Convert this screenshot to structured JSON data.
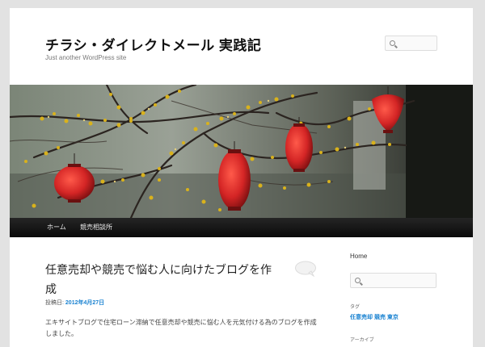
{
  "site": {
    "title": "チラシ・ダイレクトメール 実践記",
    "description": "Just another WordPress site"
  },
  "nav": {
    "items": [
      {
        "label": "ホーム"
      },
      {
        "label": "競売相談所"
      }
    ]
  },
  "post": {
    "title": "任意売却や競売で悩む人に向けたブログを作成",
    "meta_label": "投稿日:",
    "date": "2012年4月27日",
    "excerpt": "エキサイトブログで住宅ローン滞納で任意売却や競売に悩む人を元気付ける為のブログを作成しました。"
  },
  "sidebar": {
    "home_label": "Home",
    "categories_heading": "タグ",
    "category_links": "任意売却 競売 東京",
    "archives_heading": "アーカイブ"
  },
  "colors": {
    "link": "#1982d1",
    "nav_bg": "#111111",
    "lantern": "#d42525",
    "blossom": "#d9b21c"
  }
}
